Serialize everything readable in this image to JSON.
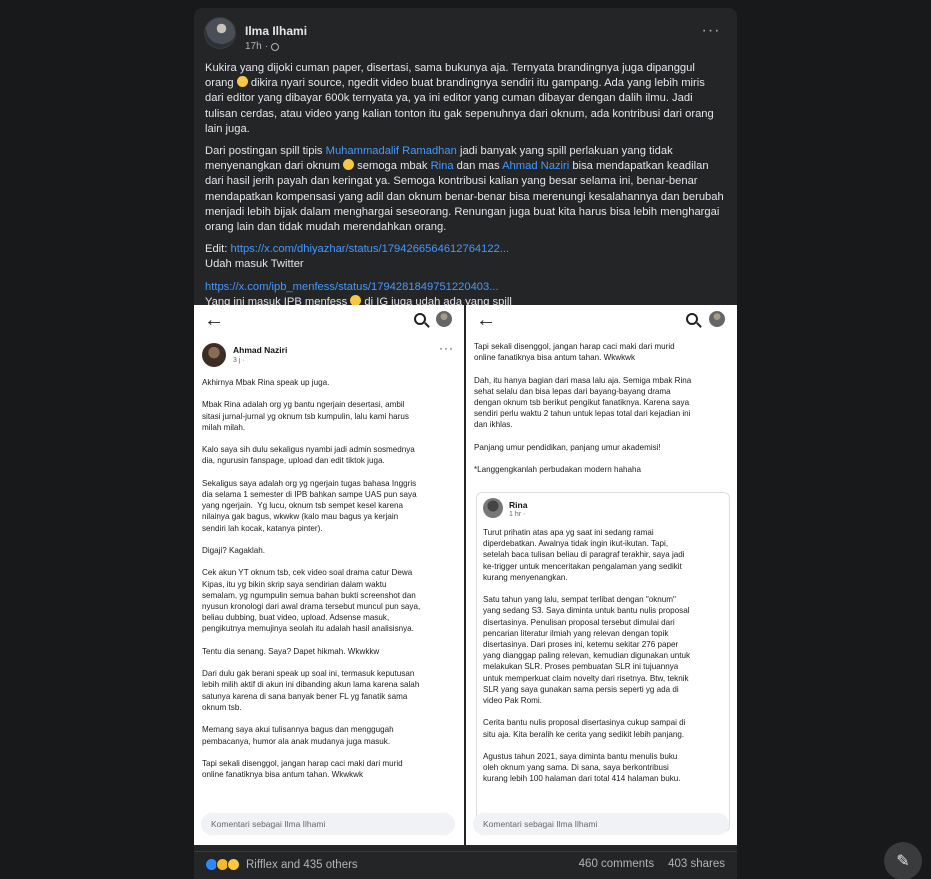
{
  "post": {
    "author": "Ilma Ilhami",
    "time": "17h",
    "paragraph1": "Kukira yang dijoki cuman paper, disertasi, sama bukunya aja. Ternyata brandingnya juga dipanggul orang",
    "paragraph1b": " dikira nyari source, ngedit video buat brandingnya sendiri itu gampang. Ada yang lebih miris dari editor yang dibayar 600k ternyata ya, ya ini editor yang cuman dibayar dengan dalih ilmu. Jadi tulisan cerdas, atau video yang kalian tonton itu gak sepenuhnya dari oknum, ada kontribusi dari orang lain juga.",
    "p2_part1": "Dari postingan spill tipis ",
    "p2_link1": "Muhammadalif Ramadhan",
    "p2_part2": " jadi banyak yang spill perlakuan yang tidak menyenangkan dari oknum ",
    "p2_part3": " semoga mbak ",
    "p2_link2": "Rina",
    "p2_part4": " dan mas ",
    "p2_link3": "Ahmad Naziri",
    "p2_part5": " bisa mendapatkan keadilan dari hasil jerih payah dan keringat ya. Semoga kontribusi kalian yang besar selama ini, benar-benar mendapatkan kompensasi yang adil dan oknum benar-benar bisa merenungi kesalahannya dan berubah menjadi lebih bijak dalam menghargai seseorang. Renungan juga buat kita harus bisa lebih menghargai orang lain dan tidak mudah merendahkan orang.",
    "edit_label": "Edit: ",
    "edit_link": "https://x.com/dhiyazhar/status/1794266564612764122...",
    "twitter_line": "Udah masuk Twitter",
    "ipb_link": "https://x.com/ipb_menfess/status/1794281849751220403...",
    "ipb_line_a": "Yang ini masuk IPB menfess ",
    "ipb_line_b": " di IG juga udah ada yang spill"
  },
  "left_screenshot": {
    "author": "Ahmad Naziri",
    "meta": "3 j · ",
    "text": "Akhirnya Mbak Rina speak up juga.\n\nMbak Rina adalah org yg bantu ngerjain desertasi, ambil\nsitasi jurnal-jurnal yg oknum tsb kumpulin, lalu kami harus\nmilah milah.\n\nKalo saya sih dulu sekaligus nyambi jadi admin sosmednya\ndia, ngurusin fanspage, upload dan edit tiktok juga.\n\nSekaligus saya adalah org yg ngerjain tugas bahasa Inggris\ndia selama 1 semester di IPB bahkan sampe UAS pun saya\nyang ngerjain.  Yg lucu, oknum tsb sempet kesel karena\nnilainya gak bagus, wkwkw (kalo mau bagus ya kerjain\nsendiri lah kocak, katanya pinter).\n\nDigaji? Kagaklah.\n\nCek akun YT oknum tsb, cek video soal drama catur Dewa\nKipas, itu yg bikin skrip saya sendirian dalam waktu\nsemalam, yg ngumpulin semua bahan bukti screenshot dan\nnyusun kronologi dari awal drama tersebut muncul pun saya,\nbeliau dubbing, buat video, upload. Adsense masuk,\npengikutnya memujinya seolah itu adalah hasil analisisnya.\n\nTentu dia senang. Saya? Dapet hikmah. Wkwkkw\n\nDari dulu gak berani speak up soal ini, termasuk keputusan\nlebih milih aktif di akun ini dibanding akun lama karena salah\nsatunya karena di sana banyak bener FL yg fanatik sama\noknum tsb.\n\nMemang saya akui tulisannya bagus dan menggugah\npembacanya, humor ala anak mudanya juga masuk.\n\nTapi sekali disenggol, jangan harap caci maki dari murid\nonline fanatiknya bisa antum tahan. Wkwkwk",
    "comment_placeholder": "Komentari sebagai Ilma Ilhami"
  },
  "right_screenshot": {
    "text_top": "Tapi sekali disenggol, jangan harap caci maki dari murid\nonline fanatiknya bisa antum tahan. Wkwkwk\n\nDah, itu hanya bagian dari masa lalu aja. Semiga mbak Rina\nsehat selalu dan bisa lepas dari bayang-bayang drama\ndengan oknum tsb berikut pengikut fanatiknya. Karena saya\nsendiri perlu waktu 2 tahun untuk lepas total dari kejadian ini\ndan ikhlas.\n\nPanjang umur pendidikan, panjang umur akademisi!\n\n*Langgengkanlah perbudakan modern hahaha",
    "nested_author": "Rina",
    "nested_meta": "1 hr · ",
    "nested_text": "Turut prihatin atas apa yg saat ini sedang ramai\ndiperdebatkan. Awalnya tidak ingin ikut-ikutan. Tapi,\nsetelah baca tulisan beliau di paragraf terakhir, saya jadi\nke-trigger untuk menceritakan pengalaman yang sedikit\nkurang menyenangkan.\n\nSatu tahun yang lalu, sempat terlibat dengan \"oknum\"\nyang sedang S3. Saya diminta untuk bantu nulis proposal\ndisertasinya. Penulisan proposal tersebut dimulai dari\npencarian literatur ilmiah yang relevan dengan topik\ndisertasinya. Dari proses ini, ketemu sekitar 276 paper\nyang dianggap paling relevan, kemudian digunakan untuk\nmelakukan SLR. Proses pembuatan SLR ini tujuannya\nuntuk memperkuat claim novelty dari risetnya. Btw, teknik\nSLR yang saya gunakan sama persis seperti yg ada di\nvideo Pak Romi.\n\nCerita bantu nulis proposal disertasinya cukup sampai di\nsitu aja. Kita beralih ke cerita yang sedikit lebih panjang.\n\nAgustus tahun 2021, saya diminta bantu menulis buku\noleh oknum yang sama. Di sana, saya berkontribusi\nkurang lebih 100 halaman dari total 414 halaman buku.",
    "comment_placeholder": "Komentari sebagai Ilma Ilhami"
  },
  "footer": {
    "reactions_label": "Rifflex and 435 others",
    "comments": "460 comments",
    "shares": "403 shares"
  },
  "icons": {
    "more": "more-horizontal-icon",
    "compose": "compose-icon"
  }
}
